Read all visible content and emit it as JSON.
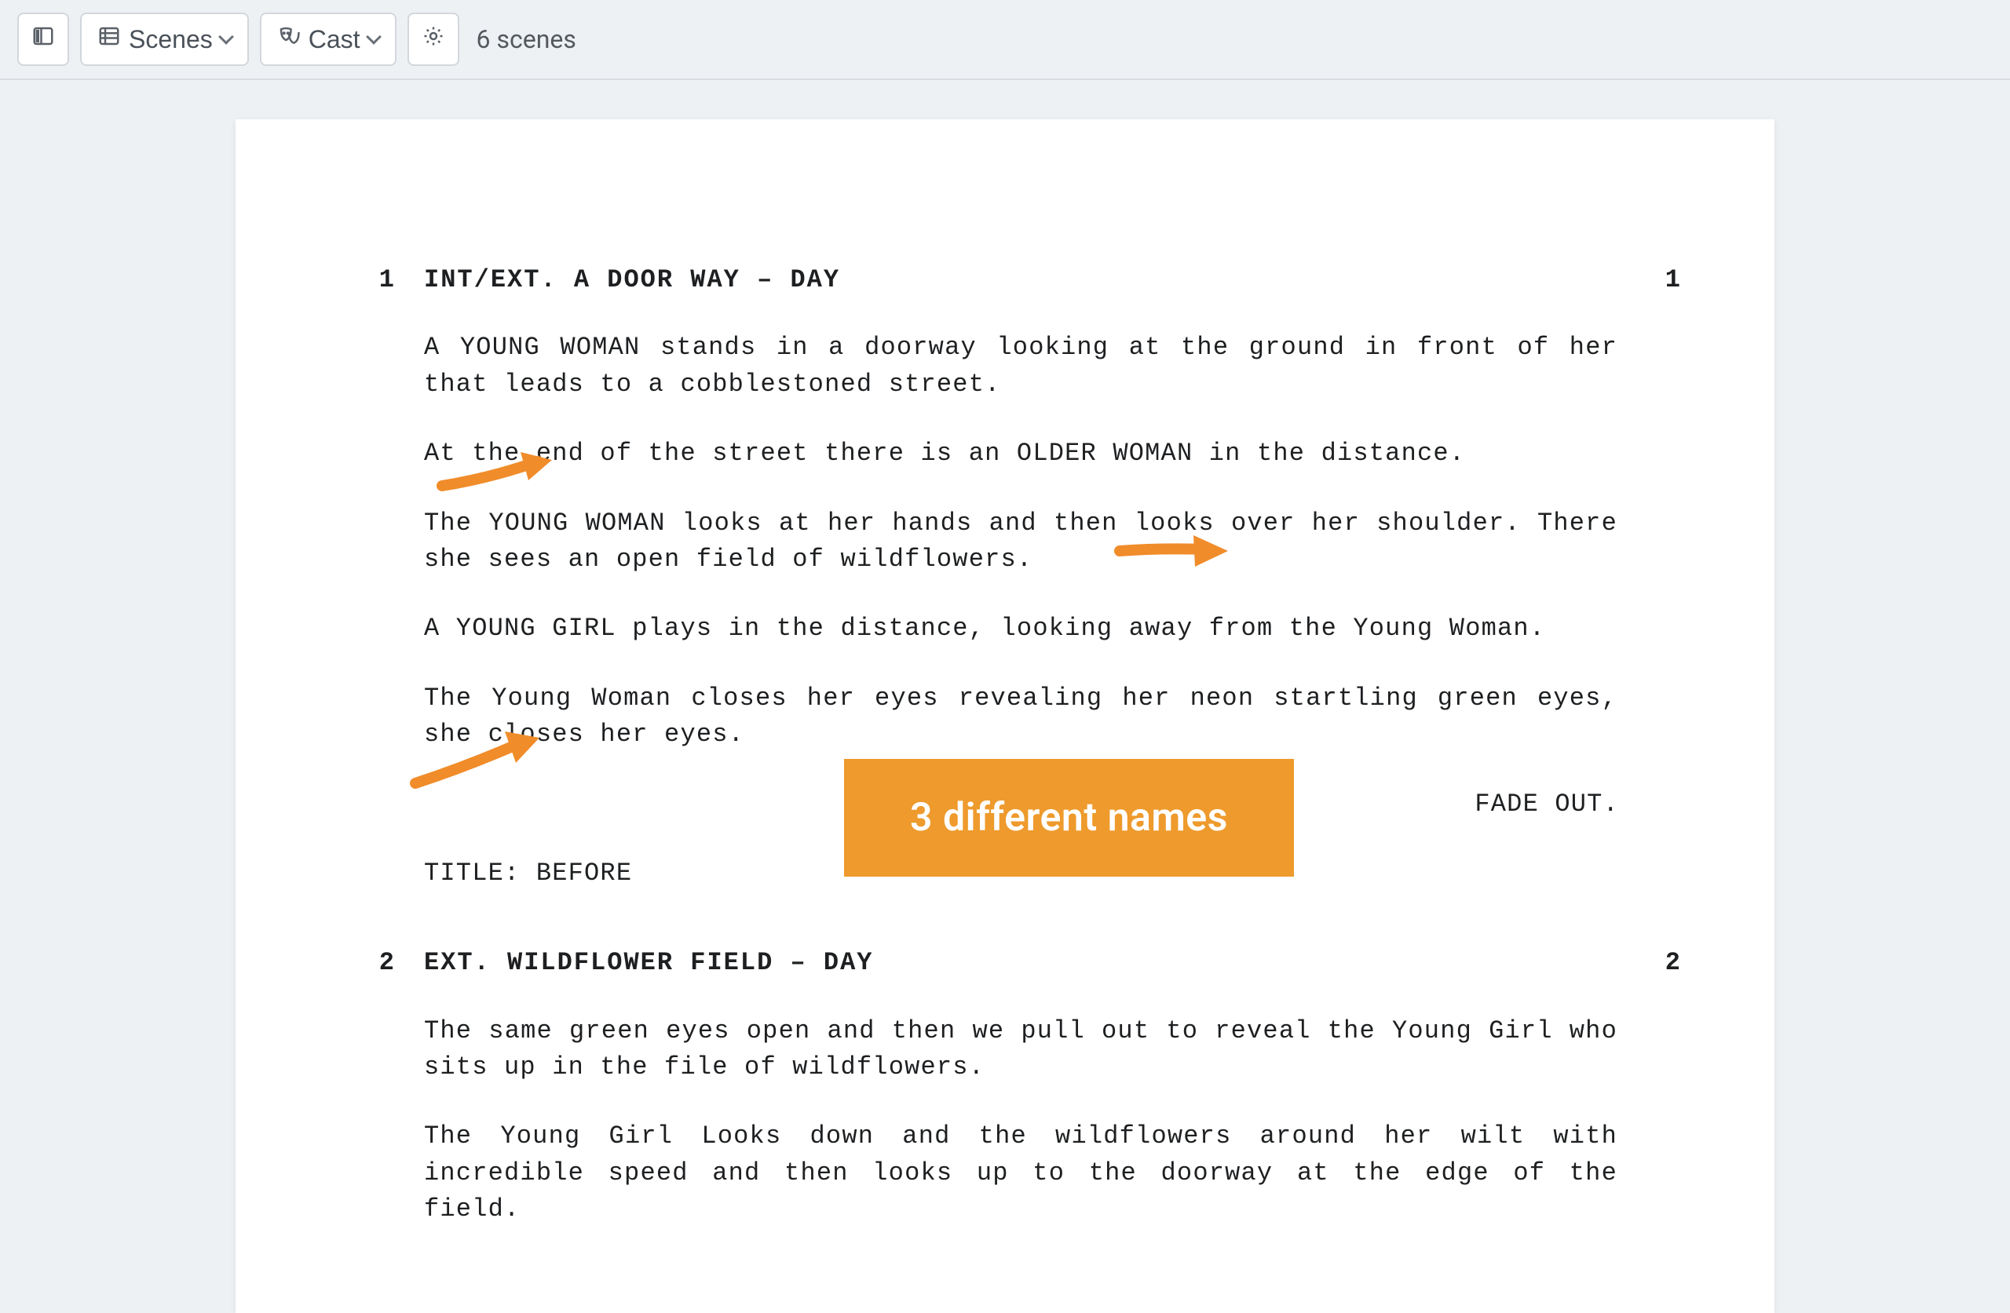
{
  "toolbar": {
    "scenes_label": "Scenes",
    "cast_label": "Cast",
    "count_label": "6 scenes"
  },
  "scenes": [
    {
      "num": "1",
      "heading": "INT/EXT. A DOOR WAY – DAY",
      "actions": [
        "A YOUNG WOMAN stands in a doorway looking at the ground in front of her that leads to a cobblestoned street.",
        "At the end of the street there is an OLDER WOMAN in the distance.",
        "The YOUNG WOMAN looks at her hands and then looks over her shoulder. There she sees an open field of wildflowers.",
        "A YOUNG GIRL plays in the distance, looking away from the Young Woman.",
        "The Young Woman closes her eyes revealing her neon startling green eyes, she closes her eyes."
      ],
      "transition": "FADE OUT.",
      "title_card": "TITLE: BEFORE"
    },
    {
      "num": "2",
      "heading": "EXT. WILDFLOWER FIELD – DAY",
      "actions": [
        "The same green eyes open and then we pull out to reveal the Young Girl who sits up in the file of wildflowers.",
        "The Young Girl Looks down and the wildflowers around her wilt with incredible speed and then looks up to the doorway at the edge of the field."
      ]
    }
  ],
  "annotation": {
    "label": "3 different names"
  }
}
